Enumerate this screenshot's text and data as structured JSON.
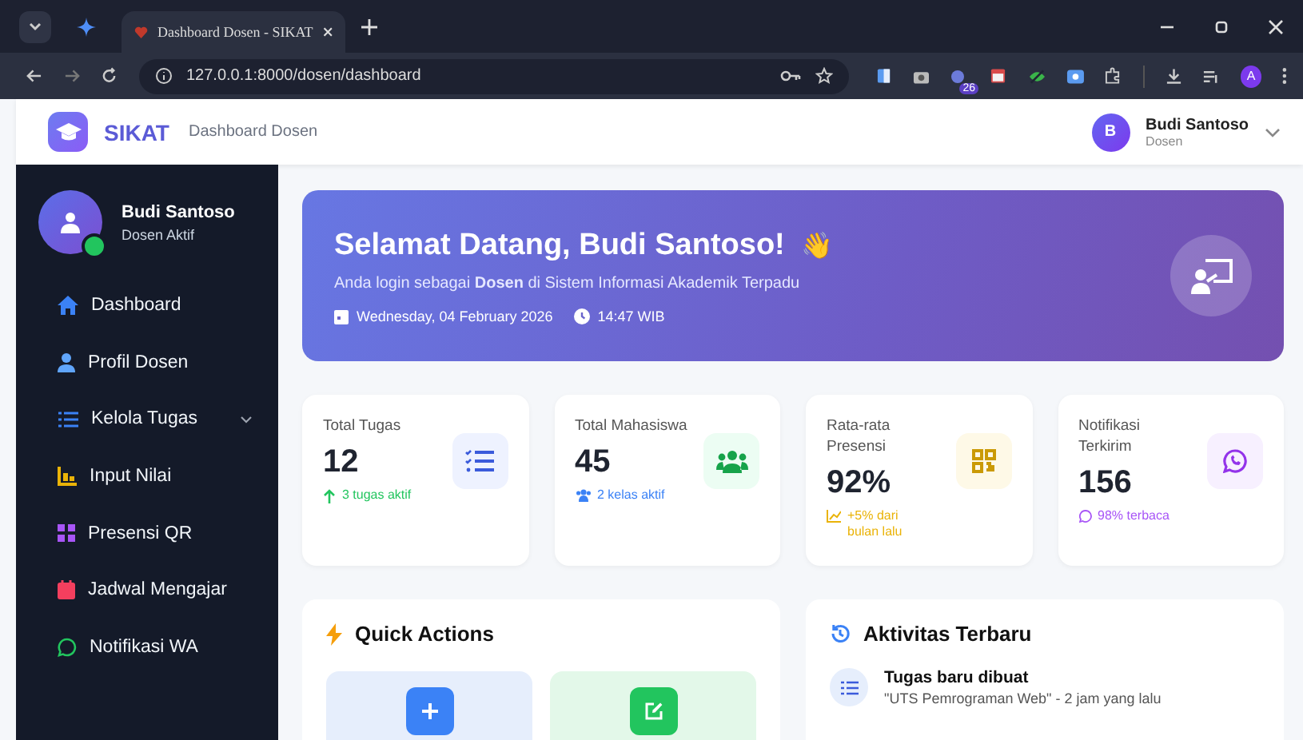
{
  "browser": {
    "tab_title": "Dashboard Dosen - SIKAT",
    "url": "127.0.0.1:8000/dosen/dashboard",
    "extension_badge": "26",
    "profile_initial": "A"
  },
  "header": {
    "brand": "SIKAT",
    "subtitle": "Dashboard Dosen",
    "user": {
      "initial": "B",
      "name": "Budi Santoso",
      "role": "Dosen"
    }
  },
  "sidebar": {
    "profile": {
      "name": "Budi Santoso",
      "status": "Dosen Aktif",
      "online": true
    },
    "items": [
      {
        "label": "Dashboard"
      },
      {
        "label": "Profil Dosen"
      },
      {
        "label": "Kelola Tugas",
        "expanded": false
      },
      {
        "label": "Input Nilai"
      },
      {
        "label": "Presensi QR"
      },
      {
        "label": "Jadwal Mengajar"
      },
      {
        "label": "Notifikasi WA"
      }
    ]
  },
  "welcome": {
    "title": "Selamat Datang, Budi Santoso!",
    "emoji": "👋",
    "subtitle": "Anda login sebagai **Dosen** di Sistem Informasi Akademik Terpadu",
    "date": "Wednesday, 04 February 2026",
    "time": "14:47 WIB"
  },
  "stats": [
    {
      "label": "Total Tugas",
      "value": "12",
      "note": "3 tugas aktif",
      "color": "#22c55e"
    },
    {
      "label": "Total Mahasiswa",
      "value": "45",
      "note": "2 kelas aktif",
      "color": "#3b82f6"
    },
    {
      "label": "Rata-rata Presensi",
      "value": "92%",
      "note": "+5% dari bulan lalu",
      "color": "#eab308"
    },
    {
      "label": "Notifikasi Terkirim",
      "value": "156",
      "note": "98% terbaca",
      "color": "#a855f7"
    }
  ],
  "quick_actions": {
    "title": "Quick Actions"
  },
  "activity": {
    "title": "Aktivitas Terbaru",
    "items": [
      {
        "title": "Tugas baru dibuat",
        "detail": "\"UTS Pemrograman Web\" - 2 jam yang lalu"
      }
    ]
  }
}
